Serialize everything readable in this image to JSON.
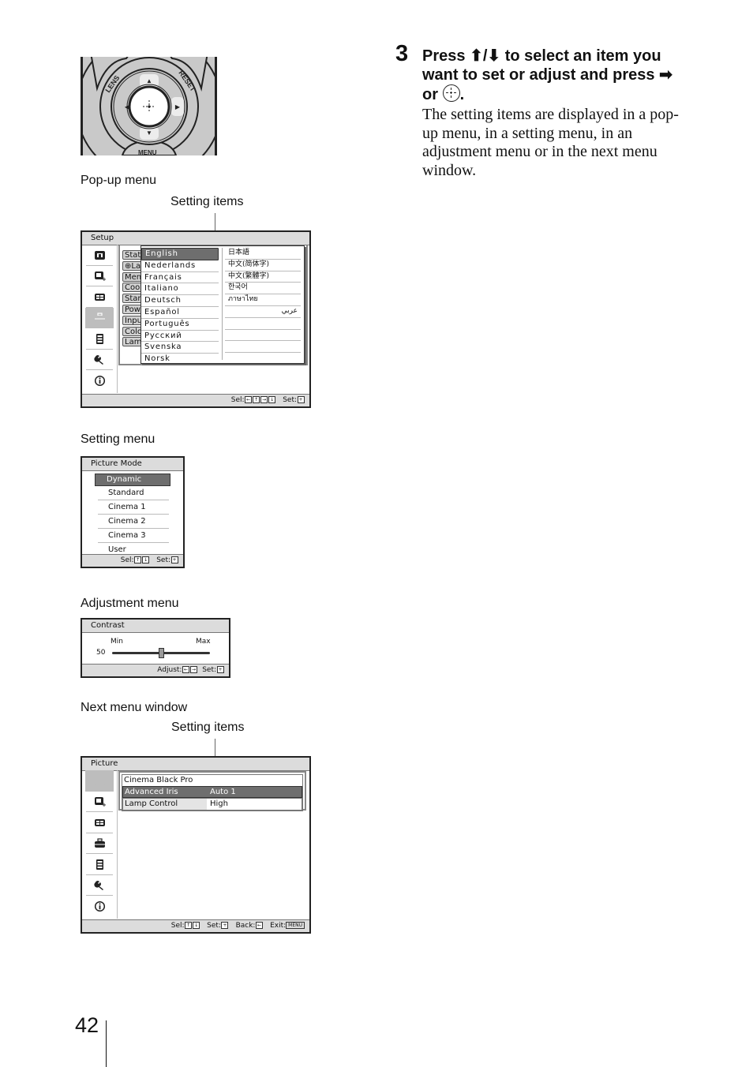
{
  "remote": {
    "buttons": [
      "LENS",
      "RESET",
      "MENU"
    ],
    "highlighted_keys": [
      "up",
      "right",
      "down"
    ]
  },
  "popup_section": {
    "caption": "Pop-up menu",
    "leader_label": "Setting items",
    "window_title": "Setup",
    "sidebar_icons": [
      "picture-icon",
      "advanced-picture-icon",
      "screen-icon",
      "setup-icon",
      "function-icon",
      "installation-icon",
      "information-icon"
    ],
    "selected_sidebar_index": 3,
    "background_items": [
      "Stat",
      "La",
      "Men",
      "Coo",
      "Star",
      "Pow",
      "Inpu",
      "Colo",
      "Lam"
    ],
    "languages_left": [
      "English",
      "Nederlands",
      "Français",
      "Italiano",
      "Deutsch",
      "Español",
      "Português",
      "Русский",
      "Svenska",
      "Norsk"
    ],
    "languages_right": [
      "日本語",
      "中文(简体字)",
      "中文(繁體字)",
      "한국어",
      "ภาษาไทย",
      "عربي",
      "",
      "",
      ""
    ],
    "selected_language": "English",
    "footer": {
      "sel_label": "Sel:",
      "set_label": "Set:"
    }
  },
  "setting_section": {
    "caption": "Setting menu",
    "window_title": "Picture Mode",
    "options": [
      "Dynamic",
      "Standard",
      "Cinema 1",
      "Cinema 2",
      "Cinema 3",
      "User"
    ],
    "selected_option": "Dynamic",
    "footer": {
      "sel_label": "Sel:",
      "set_label": "Set:"
    }
  },
  "adjustment_section": {
    "caption": "Adjustment menu",
    "window_title": "Contrast",
    "min_label": "Min",
    "max_label": "Max",
    "value": "50",
    "slider_fraction": 0.5,
    "footer": {
      "adjust_label": "Adjust:",
      "set_label": "Set:"
    }
  },
  "next_section": {
    "caption": "Next menu window",
    "leader_label": "Setting items",
    "window_title": "Picture",
    "selected_sidebar_index": 0,
    "items": [
      {
        "label": "Cinema Black Pro",
        "value": ""
      },
      {
        "label": "Advanced Iris",
        "value": "Auto 1"
      },
      {
        "label": "Lamp Control",
        "value": "High"
      }
    ],
    "selected_item": "Advanced Iris",
    "footer": {
      "sel_label": "Sel:",
      "set_label": "Set:",
      "back_label": "Back:",
      "exit_label": "Exit:",
      "menu_key": "MENU"
    }
  },
  "instructions": {
    "step_number": "3",
    "heading_part1": "Press ",
    "heading_part2": " to select an item you want to set or adjust and press ",
    "heading_part3": " or ",
    "heading_end": ".",
    "body": "The setting items are displayed in a pop-up menu, in a setting menu, in an adjustment menu or in the next menu window."
  },
  "page_number": "42"
}
